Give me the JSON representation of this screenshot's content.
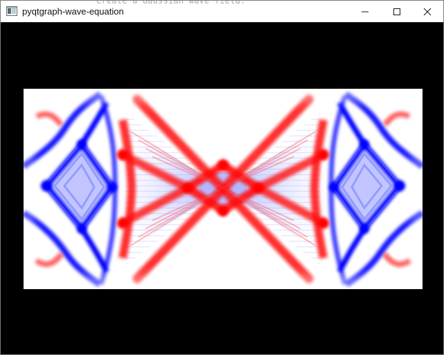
{
  "window": {
    "title": "pyqtgraph-wave-equation",
    "overlap_text": "Create a Gaussian wave field.",
    "controls": {
      "minimize_icon": "minimize-icon",
      "maximize_icon": "maximize-icon",
      "close_icon": "close-icon"
    }
  },
  "plot": {
    "background_color": "#000000",
    "colormap": {
      "negative": "#0000ff",
      "zero": "#ffffff",
      "positive": "#ff0000"
    }
  }
}
